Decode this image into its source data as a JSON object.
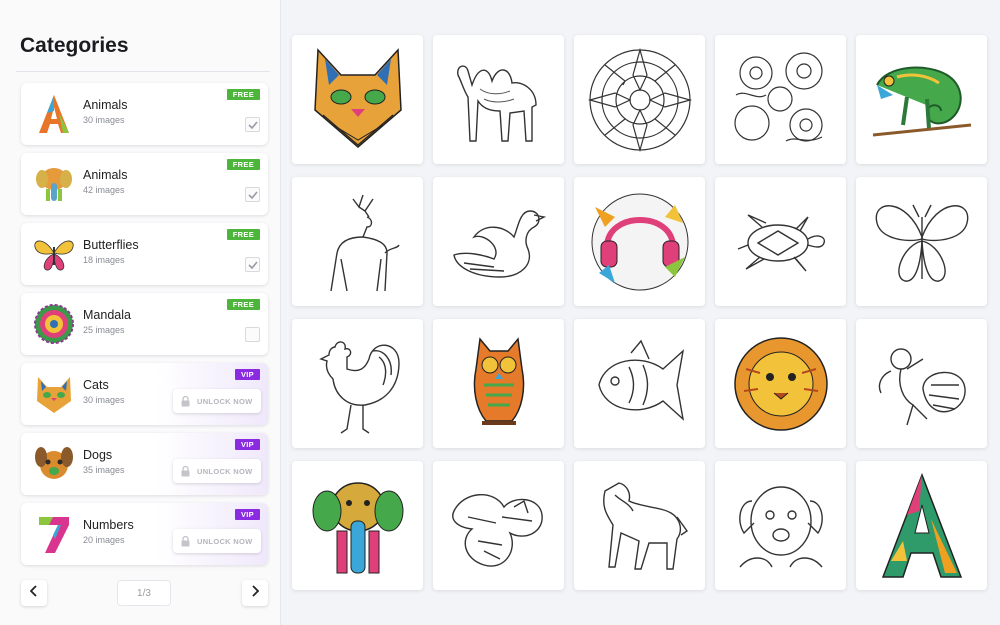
{
  "sidebar": {
    "title": "Categories",
    "categories": [
      {
        "name": "Animals",
        "count": "30 images",
        "badge": "FREE",
        "icon": "letter-a-icon"
      },
      {
        "name": "Animals",
        "count": "42 images",
        "badge": "FREE",
        "icon": "elephant-icon"
      },
      {
        "name": "Butterflies",
        "count": "18 images",
        "badge": "FREE",
        "icon": "butterfly-icon"
      },
      {
        "name": "Mandala",
        "count": "25 images",
        "badge": "FREE",
        "icon": "mandala-icon"
      },
      {
        "name": "Cats",
        "count": "30 images",
        "badge": "VIP",
        "unlock": "UNLOCK NOW",
        "icon": "cat-icon"
      },
      {
        "name": "Dogs",
        "count": "35 images",
        "badge": "VIP",
        "unlock": "UNLOCK NOW",
        "icon": "dog-icon"
      },
      {
        "name": "Numbers",
        "count": "20 images",
        "badge": "VIP",
        "unlock": "UNLOCK NOW",
        "icon": "number-7-icon"
      }
    ],
    "pagination": {
      "label": "1/3"
    }
  },
  "colors": {
    "free_badge": "#4db53c",
    "vip_badge": "#8a2be2",
    "accent_orange": "#f0a020",
    "accent_green": "#45a84a",
    "accent_pink": "#e0407a"
  },
  "gallery": {
    "images": [
      {
        "name": "cat-face-colored-icon"
      },
      {
        "name": "camel-icon"
      },
      {
        "name": "flower-mandala-icon"
      },
      {
        "name": "floral-pattern-icon"
      },
      {
        "name": "chameleon-colored-icon"
      },
      {
        "name": "deer-icon"
      },
      {
        "name": "swan-icon"
      },
      {
        "name": "headphones-colored-icon"
      },
      {
        "name": "turtle-icon"
      },
      {
        "name": "butterfly-icon"
      },
      {
        "name": "rooster-icon"
      },
      {
        "name": "owl-colored-icon"
      },
      {
        "name": "fish-icon"
      },
      {
        "name": "lion-colored-icon"
      },
      {
        "name": "cupid-icon"
      },
      {
        "name": "elephant-colored-icon"
      },
      {
        "name": "pattern-shapes-icon"
      },
      {
        "name": "horse-icon"
      },
      {
        "name": "dog-face-icon"
      },
      {
        "name": "letter-a-colored-icon"
      }
    ]
  }
}
